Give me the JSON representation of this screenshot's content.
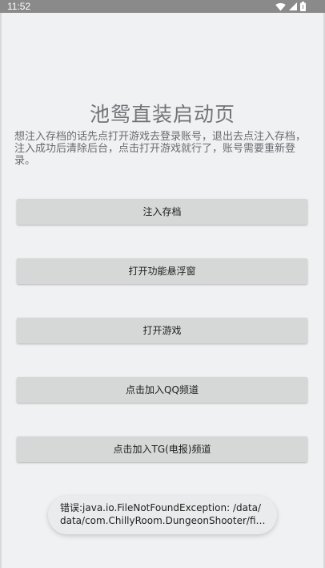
{
  "status_bar": {
    "time": "11:52",
    "icons": [
      "wifi-icon",
      "signal-icon",
      "battery-icon"
    ]
  },
  "page": {
    "title": "池鸳直装启动页",
    "description": "想注入存档的话先点打开游戏去登录账号，退出去点注入存档，注入成功后清除后台，点击打开游戏就行了，账号需要重新登录。"
  },
  "buttons": {
    "inject_save": "注入存档",
    "open_float": "打开功能悬浮窗",
    "open_game": "打开游戏",
    "join_qq": "点击加入QQ频道",
    "join_tg": "点击加入TG(电报)频道"
  },
  "toast": {
    "line1": "错误:java.io.FileNotFoundException: /data/",
    "line2": "data/com.ChillyRoom.DungeonShooter/files..."
  },
  "colors": {
    "status_bar": "#8a8a8a",
    "background": "#f0f1f2",
    "button": "#d6d7d7",
    "title_text": "#707478"
  }
}
